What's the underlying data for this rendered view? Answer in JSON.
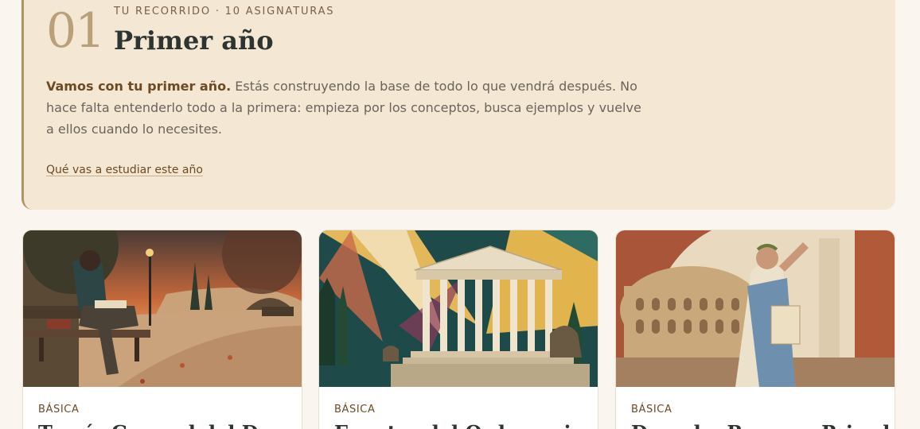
{
  "hero": {
    "number": "01",
    "eyebrow": "TU RECORRIDO · 10 ASIGNATURAS",
    "title": "Primer año",
    "intro_lead": "Vamos con tu primer año.",
    "intro_body": " Estás construyendo la base de todo lo que vendrá después. No hace falta entenderlo todo a la primera: empieza por los conceptos, busca ejemplos y vuelve a ellos cuando lo necesites.",
    "link_label": "Qué vas a estudiar este año"
  },
  "courses": [
    {
      "tag": "BÁSICA",
      "title": "Teoría General del Derecho",
      "image": "student-reading-park-illustration"
    },
    {
      "tag": "BÁSICA",
      "title": "Fuentes del Ordenamiento",
      "image": "classical-courthouse-illustration"
    },
    {
      "tag": "BÁSICA",
      "title": "Derecho Romano Privado",
      "image": "roman-colosseum-orator-illustration"
    }
  ]
}
